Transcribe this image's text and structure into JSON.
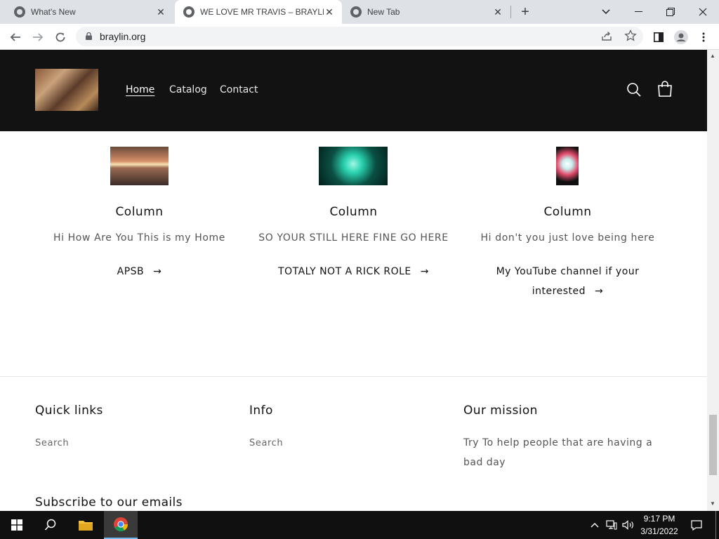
{
  "browser": {
    "tabs": [
      {
        "title": "What's New"
      },
      {
        "title": "WE LOVE MR TRAVIS – BRAYLIN.ORG"
      },
      {
        "title": "New Tab"
      }
    ],
    "new_tab": "+",
    "address": "braylin.org"
  },
  "site": {
    "nav": [
      {
        "label": "Home"
      },
      {
        "label": "Catalog"
      },
      {
        "label": "Contact"
      }
    ],
    "columns": [
      {
        "title": "Column",
        "text": "Hi How Are You This is my Home",
        "link": "APSB"
      },
      {
        "title": "Column",
        "text": "SO YOUR STILL HERE FINE GO HERE",
        "link": "TOTALY NOT A RICK ROLE"
      },
      {
        "title": "Column",
        "text": "Hi don't you just love being here",
        "link_line1": "My YouTube channel if your",
        "link_line2": "interested"
      }
    ],
    "footer": {
      "quick_links": {
        "heading": "Quick links",
        "item": "Search"
      },
      "info": {
        "heading": "Info",
        "item": "Search"
      },
      "mission": {
        "heading": "Our mission",
        "text": "Try To help people that are having a bad day"
      },
      "subscribe_heading": "Subscribe to our emails"
    }
  },
  "taskbar": {
    "time": "9:17 PM",
    "date": "3/31/2022"
  },
  "colors": {
    "header_bg": "#121212",
    "tabstrip_bg": "#dee1e6",
    "taskbar_bg": "#101010"
  }
}
